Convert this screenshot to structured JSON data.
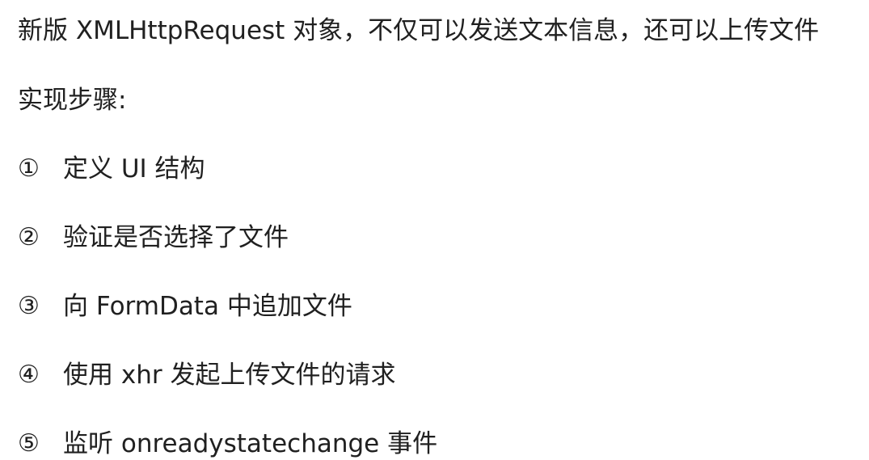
{
  "intro": "新版 XMLHttpRequest 对象，不仅可以发送文本信息，还可以上传文件",
  "heading": "实现步骤:",
  "steps": [
    {
      "num": "①",
      "text": "定义 UI 结构"
    },
    {
      "num": "②",
      "text": "验证是否选择了文件"
    },
    {
      "num": "③",
      "text": "向 FormData 中追加文件"
    },
    {
      "num": "④",
      "text": "使用 xhr 发起上传文件的请求"
    },
    {
      "num": "⑤",
      "text": "监听 onreadystatechange 事件"
    }
  ]
}
